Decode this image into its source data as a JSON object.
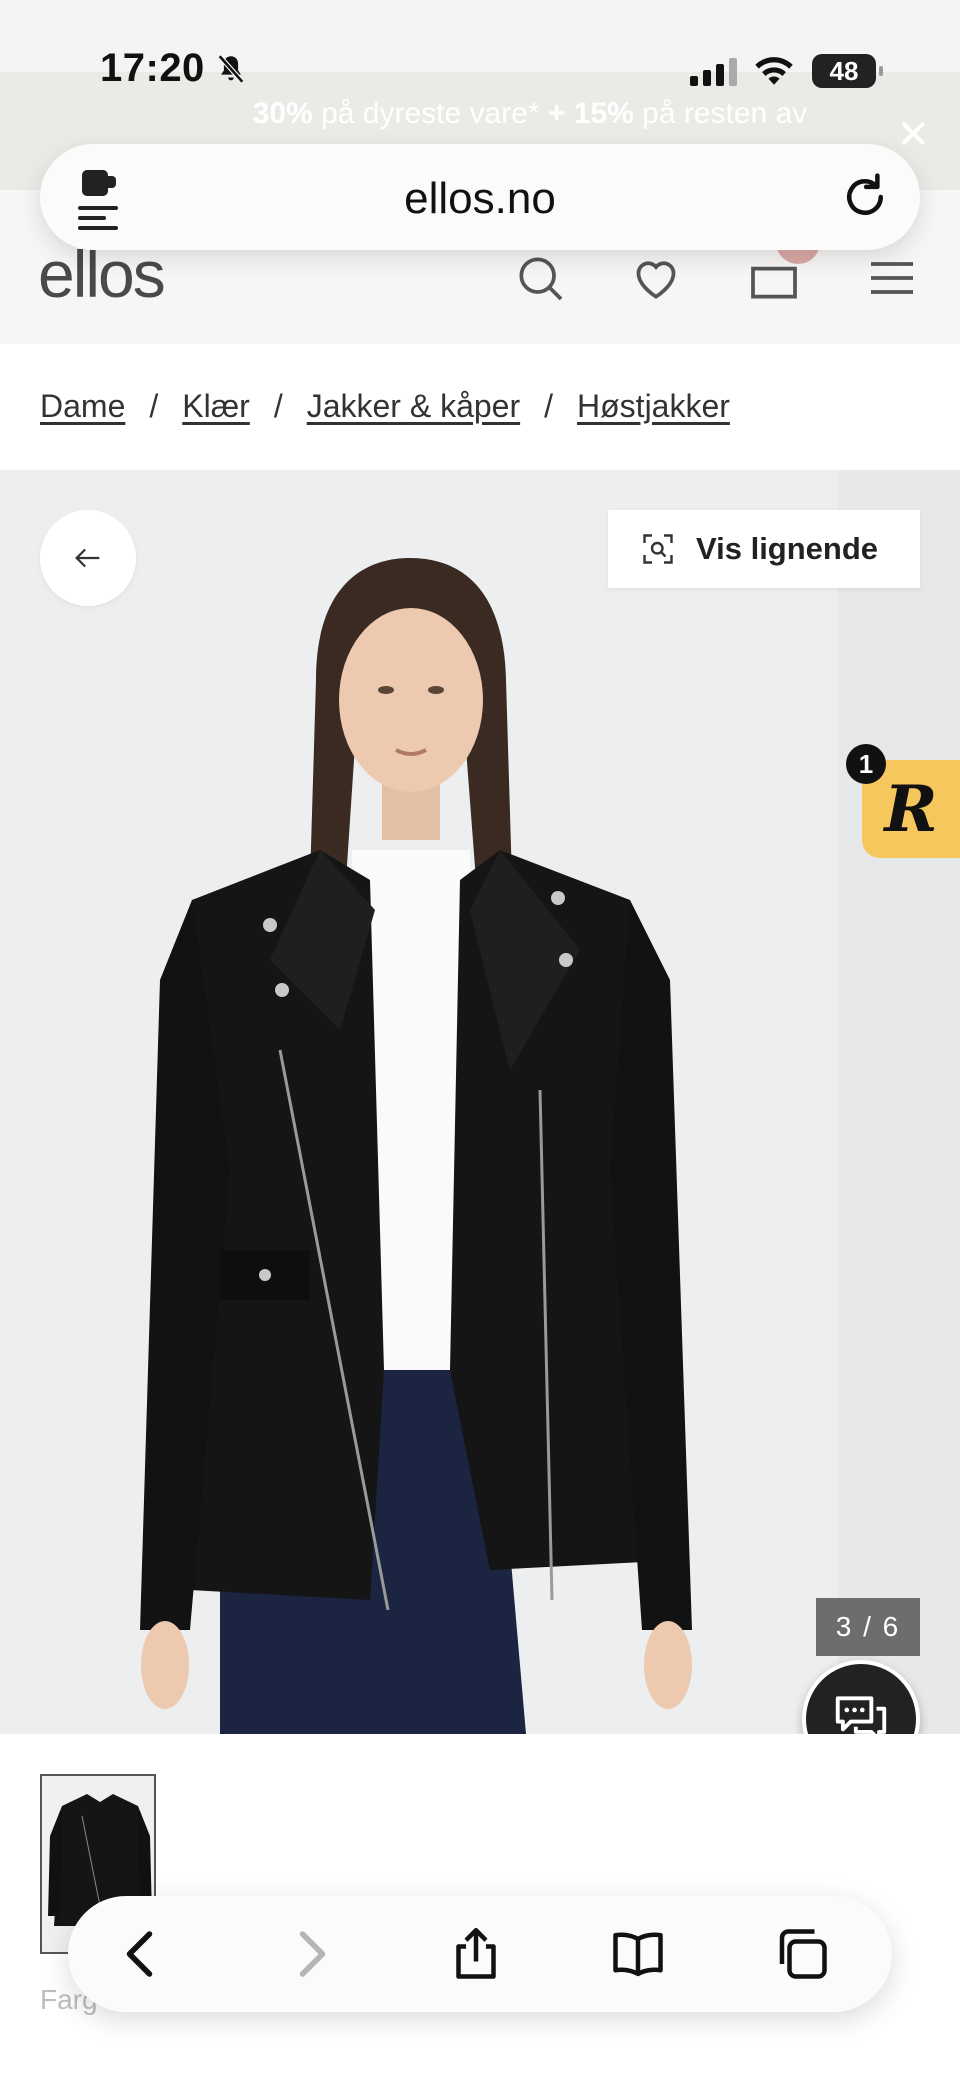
{
  "status": {
    "time": "17:20",
    "battery": "48"
  },
  "promo": {
    "bold_1": "30%",
    "text_1": " på dyreste vare* ",
    "bold_2": "+ 15%",
    "text_2": " på resten av"
  },
  "browser": {
    "url": "ellos.no"
  },
  "site": {
    "logo": "ellos"
  },
  "breadcrumb": {
    "items": [
      "Dame",
      "Klær",
      "Jakker & kåper",
      "Høstjakker"
    ],
    "separator": "/"
  },
  "product": {
    "similar_label": "Vis lignende",
    "image_counter": "3 / 6",
    "r_badge_count": "1",
    "r_logo": "R",
    "color_label": "Farg"
  },
  "colors": {
    "accent_yellow": "#f6c75c",
    "jacket": "#151515",
    "jeans": "#1b2440"
  },
  "icons": [
    "extension-icon",
    "reload-icon",
    "search-icon",
    "heart-icon",
    "cart-icon",
    "menu-icon",
    "arrow-left-icon",
    "visual-search-icon",
    "chat-icon",
    "back-icon",
    "forward-icon",
    "share-icon",
    "bookmarks-icon",
    "tabs-icon"
  ]
}
